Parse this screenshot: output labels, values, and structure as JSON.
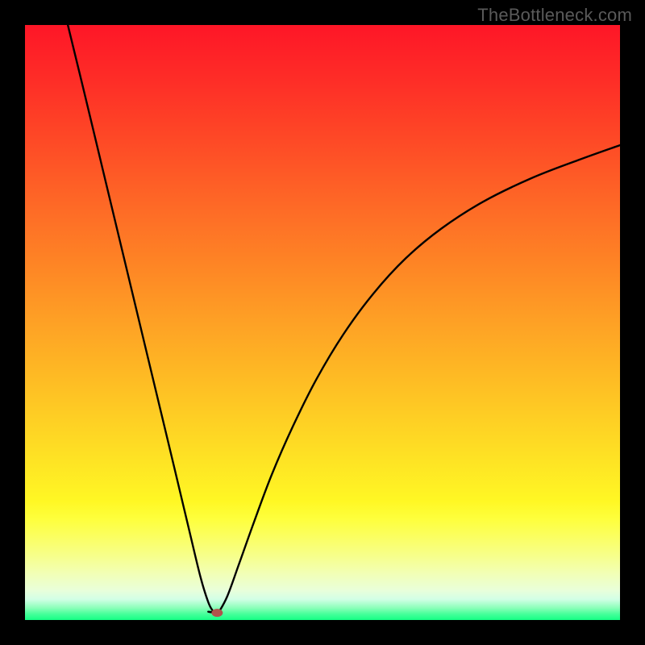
{
  "watermark": "TheBottleneck.com",
  "chart_data": {
    "type": "line",
    "title": "",
    "xlabel": "",
    "ylabel": "",
    "xlim": [
      0,
      100
    ],
    "ylim": [
      0,
      100
    ],
    "marker": {
      "x": 32.3,
      "y": 1.2,
      "color": "#b0524c",
      "rx": 7,
      "ry": 5
    },
    "gradient_stops": [
      {
        "offset": 0.0,
        "color": "#fe1627"
      },
      {
        "offset": 0.1,
        "color": "#fe2f27"
      },
      {
        "offset": 0.2,
        "color": "#fe4b26"
      },
      {
        "offset": 0.3,
        "color": "#fe6826"
      },
      {
        "offset": 0.4,
        "color": "#fe8425"
      },
      {
        "offset": 0.5,
        "color": "#fea125"
      },
      {
        "offset": 0.6,
        "color": "#febd24"
      },
      {
        "offset": 0.7,
        "color": "#feda24"
      },
      {
        "offset": 0.8,
        "color": "#fff724"
      },
      {
        "offset": 0.83,
        "color": "#feff3c"
      },
      {
        "offset": 0.86,
        "color": "#fbff61"
      },
      {
        "offset": 0.89,
        "color": "#f7ff88"
      },
      {
        "offset": 0.92,
        "color": "#f2ffb3"
      },
      {
        "offset": 0.95,
        "color": "#e9ffda"
      },
      {
        "offset": 0.965,
        "color": "#d3ffe6"
      },
      {
        "offset": 0.98,
        "color": "#89ffb8"
      },
      {
        "offset": 0.99,
        "color": "#46ff9a"
      },
      {
        "offset": 1.0,
        "color": "#15ff85"
      }
    ],
    "series": [
      {
        "name": "left-branch",
        "x": [
          7.2,
          10,
          13,
          16,
          19,
          22,
          25,
          27.5,
          29.5,
          30.8,
          31.6,
          32.0
        ],
        "values": [
          100,
          88.5,
          76,
          63.5,
          51,
          38.5,
          26,
          15.5,
          7.2,
          3.0,
          1.5,
          1.2
        ]
      },
      {
        "name": "valley-floor",
        "x": [
          30.8,
          32.5
        ],
        "values": [
          1.4,
          1.2
        ]
      },
      {
        "name": "right-branch",
        "x": [
          32.5,
          34,
          36,
          38.5,
          41.5,
          45,
          49,
          53.5,
          58.5,
          64,
          70,
          77,
          85,
          93,
          100
        ],
        "values": [
          1.2,
          4.0,
          9.5,
          16.5,
          24.5,
          32.5,
          40.5,
          48,
          54.8,
          60.8,
          65.8,
          70.3,
          74.2,
          77.3,
          79.8
        ]
      }
    ]
  }
}
